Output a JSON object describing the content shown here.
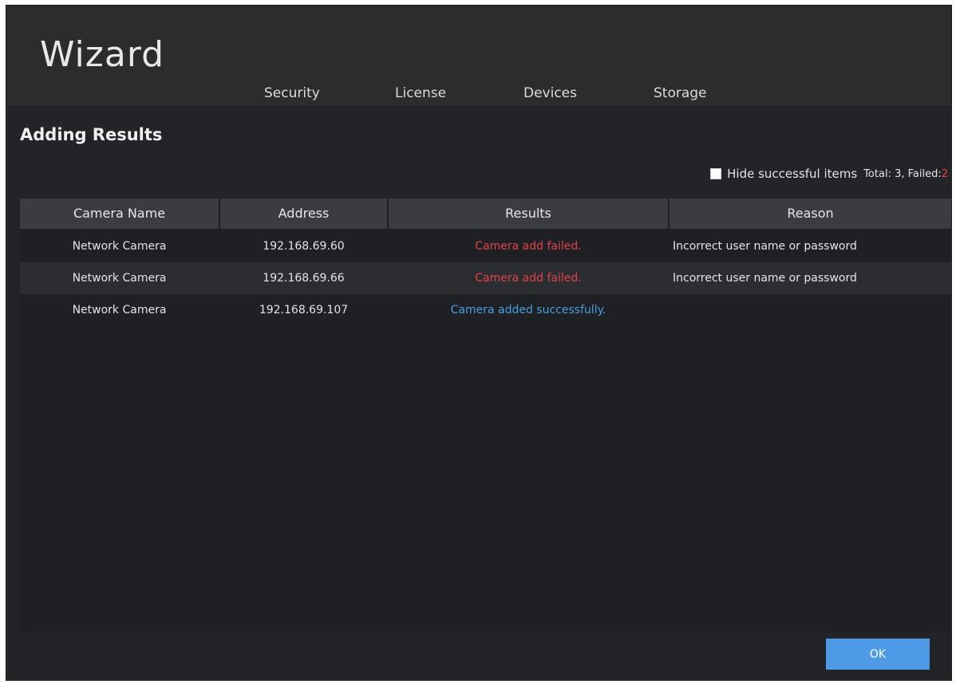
{
  "window": {
    "title": "Wizard"
  },
  "steps": [
    "Security",
    "License",
    "Devices",
    "Storage"
  ],
  "section_title": "Adding Results",
  "filter": {
    "hide_label": "Hide successful items",
    "checked": false,
    "totals_prefix": "Total: 3, Failed:",
    "failed_count": "2"
  },
  "table": {
    "columns": [
      "Camera Name",
      "Address",
      "Results",
      "Reason"
    ],
    "rows": [
      {
        "name": "Network Camera",
        "address": "192.168.69.60",
        "result": "Camera add failed.",
        "status": "failed",
        "reason": "Incorrect user name or password"
      },
      {
        "name": "Network Camera",
        "address": "192.168.69.66",
        "result": "Camera add failed.",
        "status": "failed",
        "reason": "Incorrect user name or password"
      },
      {
        "name": "Network Camera",
        "address": "192.168.69.107",
        "result": "Camera added successfully.",
        "status": "success",
        "reason": ""
      }
    ]
  },
  "colors": {
    "failed": "#e2424b",
    "success": "#4a9ee3",
    "accent": "#4f9ae6"
  },
  "ok_label": "OK"
}
